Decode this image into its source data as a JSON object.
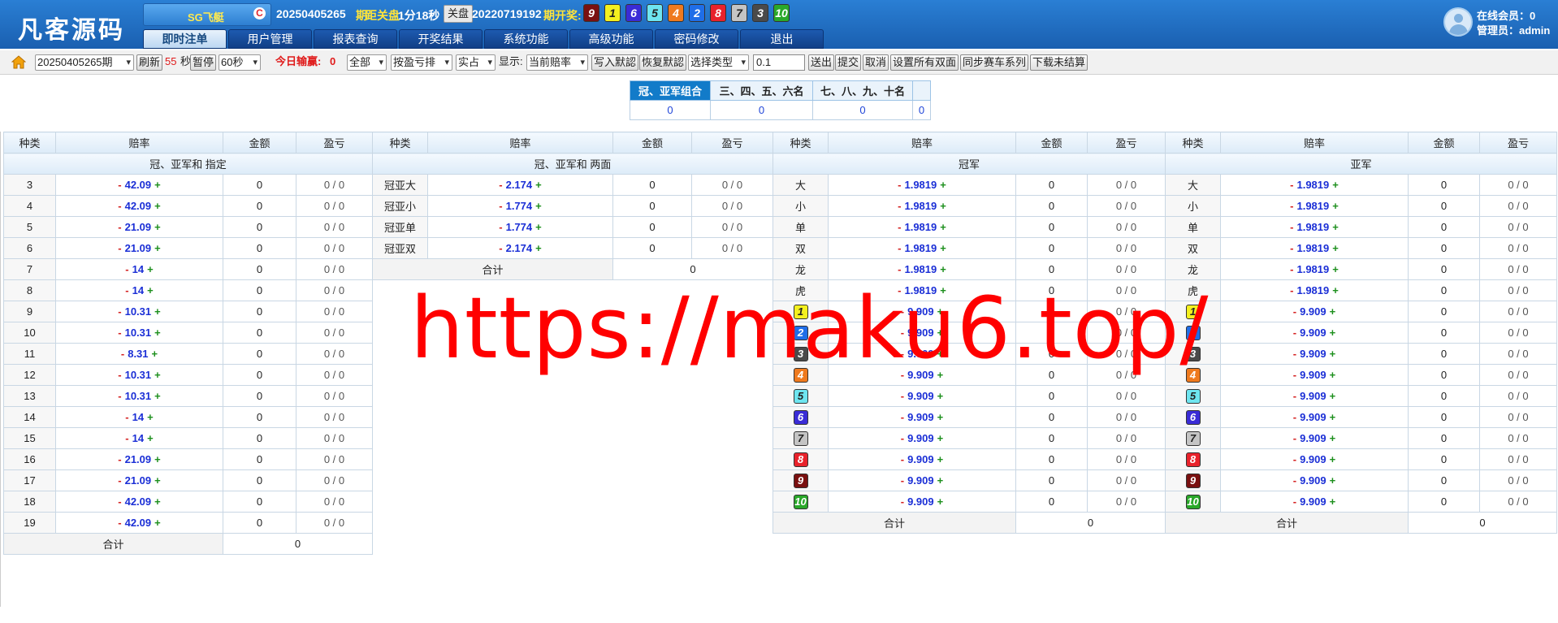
{
  "header": {
    "logo": "凡客源码",
    "game": "SG飞艇",
    "game_icon": "C",
    "period": "20250405265",
    "period_suffix": "期",
    "close_countdown_label": "距关盘:",
    "close_countdown": "1分18秒",
    "close_button": "关盘",
    "last_period": "20220719192",
    "last_period_label": "期开奖:",
    "draw_numbers": [
      "9",
      "1",
      "6",
      "5",
      "4",
      "2",
      "8",
      "7",
      "3",
      "10"
    ],
    "online_label": "在线会员：",
    "online_count": "0",
    "admin_label": "管理员：",
    "admin_name": "admin"
  },
  "ball_colors": {
    "1": {
      "bg": "#f4f01e",
      "fg": "#222"
    },
    "2": {
      "bg": "#1f6ee8",
      "fg": "#fff"
    },
    "3": {
      "bg": "#4a4a4a",
      "fg": "#fff"
    },
    "4": {
      "bg": "#ef7a1e",
      "fg": "#fff"
    },
    "5": {
      "bg": "#6ee5f0",
      "fg": "#222"
    },
    "6": {
      "bg": "#3a2cd6",
      "fg": "#fff"
    },
    "7": {
      "bg": "#c4c4c4",
      "fg": "#222"
    },
    "8": {
      "bg": "#e8222b",
      "fg": "#fff"
    },
    "9": {
      "bg": "#7a1010",
      "fg": "#fff"
    },
    "10": {
      "bg": "#2aa82a",
      "fg": "#fff"
    }
  },
  "nav": [
    "即时注单",
    "用户管理",
    "报表查询",
    "开奖结果",
    "系统功能",
    "高级功能",
    "密码修改",
    "退出"
  ],
  "toolbar": {
    "period_select": "20250405265期",
    "refresh": "刷新",
    "seconds_value": "55",
    "seconds_unit": "秒",
    "pause": "暂停",
    "interval": "60秒",
    "today_label": "今日输赢:",
    "today_value": "0",
    "all": "全部",
    "sort": "按盈亏排",
    "real": "实占",
    "display_label": "显示:",
    "current_odds": "当前赔率",
    "write_default": "写入默認",
    "restore_default": "恢复默認",
    "select_type": "选择类型",
    "amount": "0.1",
    "send": "送出",
    "submit": "提交",
    "cancel": "取消",
    "set_all_double": "设置所有双面",
    "sync_races": "同步赛车系列",
    "download_unsettled": "下载未结算"
  },
  "summary": {
    "headers": [
      "冠、亚军组合",
      "三、四、五、六名",
      "七、八、九、十名",
      ""
    ],
    "values": [
      "0",
      "0",
      "0",
      "0"
    ]
  },
  "columns": [
    "种类",
    "赔率",
    "金额",
    "盈亏"
  ],
  "table1": {
    "title": "冠、亚军和 指定",
    "rows": [
      {
        "k": "3",
        "odds": "42.09"
      },
      {
        "k": "4",
        "odds": "42.09"
      },
      {
        "k": "5",
        "odds": "21.09"
      },
      {
        "k": "6",
        "odds": "21.09"
      },
      {
        "k": "7",
        "odds": "14"
      },
      {
        "k": "8",
        "odds": "14"
      },
      {
        "k": "9",
        "odds": "10.31"
      },
      {
        "k": "10",
        "odds": "10.31"
      },
      {
        "k": "11",
        "odds": "8.31"
      },
      {
        "k": "12",
        "odds": "10.31"
      },
      {
        "k": "13",
        "odds": "10.31"
      },
      {
        "k": "14",
        "odds": "14"
      },
      {
        "k": "15",
        "odds": "14"
      },
      {
        "k": "16",
        "odds": "21.09"
      },
      {
        "k": "17",
        "odds": "21.09"
      },
      {
        "k": "18",
        "odds": "42.09"
      },
      {
        "k": "19",
        "odds": "42.09"
      }
    ]
  },
  "table2": {
    "title": "冠、亚军和 两面",
    "rows": [
      {
        "k": "冠亚大",
        "odds": "2.174"
      },
      {
        "k": "冠亚小",
        "odds": "1.774"
      },
      {
        "k": "冠亚单",
        "odds": "1.774"
      },
      {
        "k": "冠亚双",
        "odds": "2.174"
      }
    ]
  },
  "table3": {
    "title": "冠军",
    "rows": [
      {
        "k": "大",
        "odds": "1.9819"
      },
      {
        "k": "小",
        "odds": "1.9819"
      },
      {
        "k": "单",
        "odds": "1.9819"
      },
      {
        "k": "双",
        "odds": "1.9819"
      },
      {
        "k": "龙",
        "odds": "1.9819"
      },
      {
        "k": "虎",
        "odds": "1.9819"
      },
      {
        "k": "1",
        "ball": true,
        "odds": "9.909"
      },
      {
        "k": "2",
        "ball": true,
        "odds": "9.909"
      },
      {
        "k": "3",
        "ball": true,
        "odds": "9.909"
      },
      {
        "k": "4",
        "ball": true,
        "odds": "9.909"
      },
      {
        "k": "5",
        "ball": true,
        "odds": "9.909"
      },
      {
        "k": "6",
        "ball": true,
        "odds": "9.909"
      },
      {
        "k": "7",
        "ball": true,
        "odds": "9.909"
      },
      {
        "k": "8",
        "ball": true,
        "odds": "9.909"
      },
      {
        "k": "9",
        "ball": true,
        "odds": "9.909"
      },
      {
        "k": "10",
        "ball": true,
        "odds": "9.909"
      }
    ]
  },
  "table4": {
    "title": "亚军",
    "rows": [
      {
        "k": "大",
        "odds": "1.9819"
      },
      {
        "k": "小",
        "odds": "1.9819"
      },
      {
        "k": "单",
        "odds": "1.9819"
      },
      {
        "k": "双",
        "odds": "1.9819"
      },
      {
        "k": "龙",
        "odds": "1.9819"
      },
      {
        "k": "虎",
        "odds": "1.9819"
      },
      {
        "k": "1",
        "ball": true,
        "odds": "9.909"
      },
      {
        "k": "2",
        "ball": true,
        "odds": "9.909"
      },
      {
        "k": "3",
        "ball": true,
        "odds": "9.909"
      },
      {
        "k": "4",
        "ball": true,
        "odds": "9.909"
      },
      {
        "k": "5",
        "ball": true,
        "odds": "9.909"
      },
      {
        "k": "6",
        "ball": true,
        "odds": "9.909"
      },
      {
        "k": "7",
        "ball": true,
        "odds": "9.909"
      },
      {
        "k": "8",
        "ball": true,
        "odds": "9.909"
      },
      {
        "k": "9",
        "ball": true,
        "odds": "9.909"
      },
      {
        "k": "10",
        "ball": true,
        "odds": "9.909"
      }
    ]
  },
  "row_amount": "0",
  "row_profit": "0 / 0",
  "odds_minus": "-",
  "odds_plus": "+",
  "total_label": "合计",
  "total_value": "0",
  "watermark": "https://maku6.top/"
}
